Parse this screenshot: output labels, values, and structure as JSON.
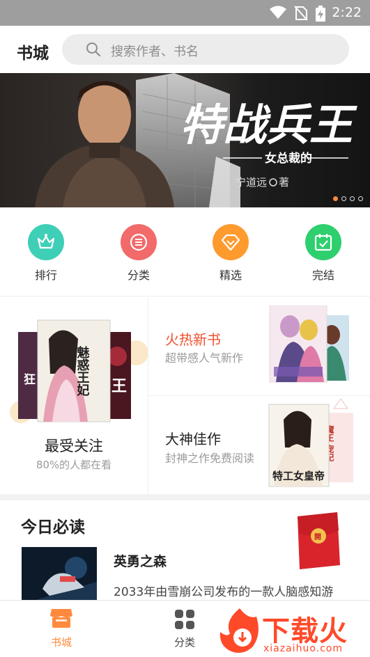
{
  "status_bar": {
    "time": "2:22"
  },
  "header": {
    "title": "书城",
    "search_placeholder": "搜索作者、书名"
  },
  "banner": {
    "title": "特战兵王",
    "subtitle": "女总裁的",
    "author": "宁道远",
    "author_suffix": "著",
    "page_count": 4,
    "active_page": 1
  },
  "categories": [
    {
      "label": "排行",
      "icon": "crown-icon",
      "color": "#3fcfb7"
    },
    {
      "label": "分类",
      "icon": "list-icon",
      "color": "#f26a6a"
    },
    {
      "label": "精选",
      "icon": "diamond-icon",
      "color": "#ff9a2e"
    },
    {
      "label": "完结",
      "icon": "calendar-check-icon",
      "color": "#2ecf6e"
    }
  ],
  "recommend": {
    "most_followed": {
      "title": "最受关注",
      "subtitle": "80%的人都在看",
      "cover_text": "魅惑王妃",
      "side_text_left": "狂 特",
      "side_text_right": "王"
    },
    "hot_new": {
      "title": "火热新书",
      "subtitle": "超带感人气新作",
      "title_color": "#f0502e"
    },
    "master": {
      "title": "大神佳作",
      "subtitle": "封神之作免费阅读",
      "cover_text": "特工女皇帝",
      "cover_text2": "魔王 宠妃"
    }
  },
  "today": {
    "section_title": "今日必读",
    "book_title": "英勇之森",
    "book_desc": "2033年由雪崩公司发布的一款人脑感知游"
  },
  "red_packet": {
    "label": "開"
  },
  "tabbar": {
    "tabs": [
      {
        "label": "书城",
        "active": true
      },
      {
        "label": "分类",
        "active": false
      }
    ],
    "accent": "#ff8a3d"
  },
  "watermark": {
    "brand": "下载火",
    "url": "xiazaihuo.com"
  }
}
